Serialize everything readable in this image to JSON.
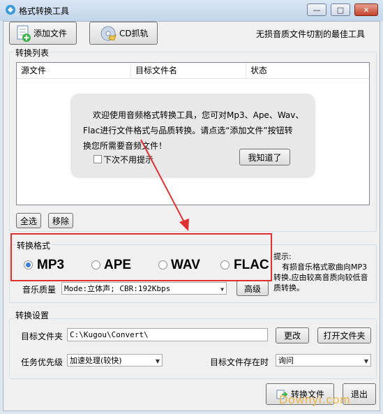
{
  "window": {
    "title": "格式转换工具",
    "controls": {
      "minimize": "—",
      "maximize": "□",
      "close": "✕"
    }
  },
  "toolbar": {
    "add_file": "添加文件",
    "cd_rip": "CD抓轨",
    "slogan": "无损音质文件切割的最佳工具"
  },
  "conversion_list": {
    "legend": "转换列表",
    "columns": [
      "源文件",
      "目标文件名",
      "状态"
    ]
  },
  "tooltip": {
    "line1": "欢迎使用音频格式转换工具，您可对Mp3、Ape、Wav、",
    "line2": "Flac进行文件格式与品质转换。请点选“添加文件”按钮转",
    "line3": "换您所需要音频文件！",
    "dont_show_label": "下次不用提示",
    "dont_show_checked": false,
    "ok_button": "我知道了"
  },
  "list_actions": {
    "select_all": "全选",
    "remove": "移除"
  },
  "format": {
    "legend": "转换格式",
    "options": [
      "MP3",
      "APE",
      "WAV",
      "FLAC"
    ],
    "selected": "MP3",
    "quality_label": "音乐质量",
    "quality_value": "Mode:立体声; CBR:192Kbps",
    "advanced_button": "高级",
    "hint_title": "提示:",
    "hint_body": "有损音乐格式歌曲向MP3转换,应由较高音质向较低音质转换。"
  },
  "settings": {
    "legend": "转换设置",
    "target_folder_label": "目标文件夹",
    "target_folder_value": "C:\\Kugou\\Convert\\",
    "change_button": "更改",
    "open_folder_button": "打开文件夹",
    "priority_label": "任务优先级",
    "priority_value": "加速处理(较快)",
    "exists_label": "目标文件存在时",
    "exists_value": "询问"
  },
  "bottom": {
    "convert_button": "转换文件",
    "exit_button": "退出"
  },
  "watermark": "Downyi.com",
  "colors": {
    "highlight_box": "#e03030",
    "radio_selected": "#3a7bd5"
  }
}
